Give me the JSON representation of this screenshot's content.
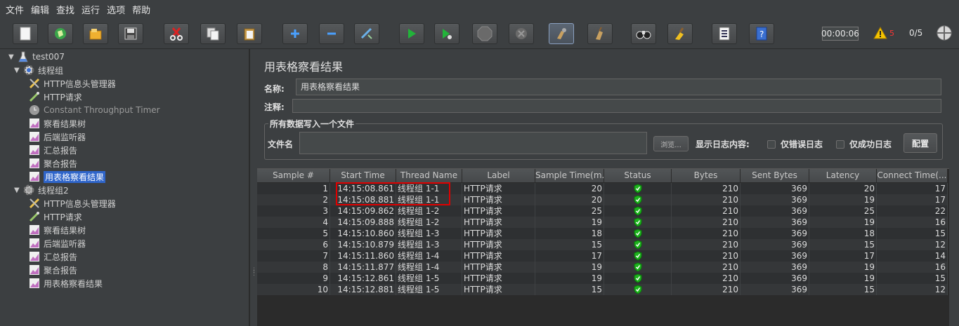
{
  "menu": [
    "文件",
    "编辑",
    "查找",
    "运行",
    "选项",
    "帮助"
  ],
  "toolbar": {
    "timer": "00:00:06",
    "warning_count": "5",
    "threads": "0/5",
    "buttons": [
      "new-icon",
      "templates-icon",
      "open-icon",
      "save-icon",
      "cut-icon",
      "copy-icon",
      "paste-icon",
      "expand-icon",
      "collapse-icon",
      "toggle-icon",
      "start-icon",
      "start-no-pause-icon",
      "stop-icon",
      "shutdown-icon",
      "clear-icon",
      "clear-all-icon",
      "search-icon",
      "reset-search-icon",
      "function-helper-icon",
      "help-icon"
    ]
  },
  "tree": {
    "root": "test007",
    "group1": "线程组",
    "group1_items": [
      "HTTP信息头管理器",
      "HTTP请求",
      "Constant Throughput Timer",
      "察看结果树",
      "后端监听器",
      "汇总报告",
      "聚合报告",
      "用表格察看结果"
    ],
    "group2": "线程组2",
    "group2_items": [
      "HTTP信息头管理器",
      "HTTP请求",
      "察看结果树",
      "后端监听器",
      "汇总报告",
      "聚合报告",
      "用表格察看结果"
    ],
    "selected": "用表格察看结果"
  },
  "panel": {
    "title": "用表格察看结果",
    "name_label": "名称:",
    "name_value": "用表格察看结果",
    "comment_label": "注释:",
    "comment_value": "",
    "file_legend": "所有数据写入一个文件",
    "file_label": "文件名",
    "file_value": "",
    "browse_label": "浏览...",
    "log_label": "显示日志内容:",
    "errors_only_label": "仅错误日志",
    "success_only_label": "仅成功日志",
    "configure_label": "配置"
  },
  "table": {
    "headers": [
      "Sample #",
      "Start Time",
      "Thread Name",
      "Label",
      "Sample Time(m...",
      "Status",
      "Bytes",
      "Sent Bytes",
      "Latency",
      "Connect Time(..."
    ],
    "rows": [
      [
        "1",
        "14:15:08.861",
        "线程组 1-1",
        "HTTP请求",
        "20",
        "ok",
        "210",
        "369",
        "20",
        "17"
      ],
      [
        "2",
        "14:15:08.881",
        "线程组 1-1",
        "HTTP请求",
        "20",
        "ok",
        "210",
        "369",
        "19",
        "17"
      ],
      [
        "3",
        "14:15:09.862",
        "线程组 1-2",
        "HTTP请求",
        "25",
        "ok",
        "210",
        "369",
        "25",
        "22"
      ],
      [
        "4",
        "14:15:09.888",
        "线程组 1-2",
        "HTTP请求",
        "19",
        "ok",
        "210",
        "369",
        "19",
        "16"
      ],
      [
        "5",
        "14:15:10.860",
        "线程组 1-3",
        "HTTP请求",
        "18",
        "ok",
        "210",
        "369",
        "18",
        "15"
      ],
      [
        "6",
        "14:15:10.879",
        "线程组 1-3",
        "HTTP请求",
        "15",
        "ok",
        "210",
        "369",
        "15",
        "12"
      ],
      [
        "7",
        "14:15:11.860",
        "线程组 1-4",
        "HTTP请求",
        "17",
        "ok",
        "210",
        "369",
        "17",
        "14"
      ],
      [
        "8",
        "14:15:11.877",
        "线程组 1-4",
        "HTTP请求",
        "19",
        "ok",
        "210",
        "369",
        "19",
        "16"
      ],
      [
        "9",
        "14:15:12.861",
        "线程组 1-5",
        "HTTP请求",
        "19",
        "ok",
        "210",
        "369",
        "19",
        "15"
      ],
      [
        "10",
        "14:15:12.881",
        "线程组 1-5",
        "HTTP请求",
        "15",
        "ok",
        "210",
        "369",
        "15",
        "12"
      ]
    ]
  },
  "colors": {
    "background": "#3c3f41",
    "selection": "#2f65ca",
    "highlight_box": "#e00000",
    "status_ok": "#1db31d"
  }
}
